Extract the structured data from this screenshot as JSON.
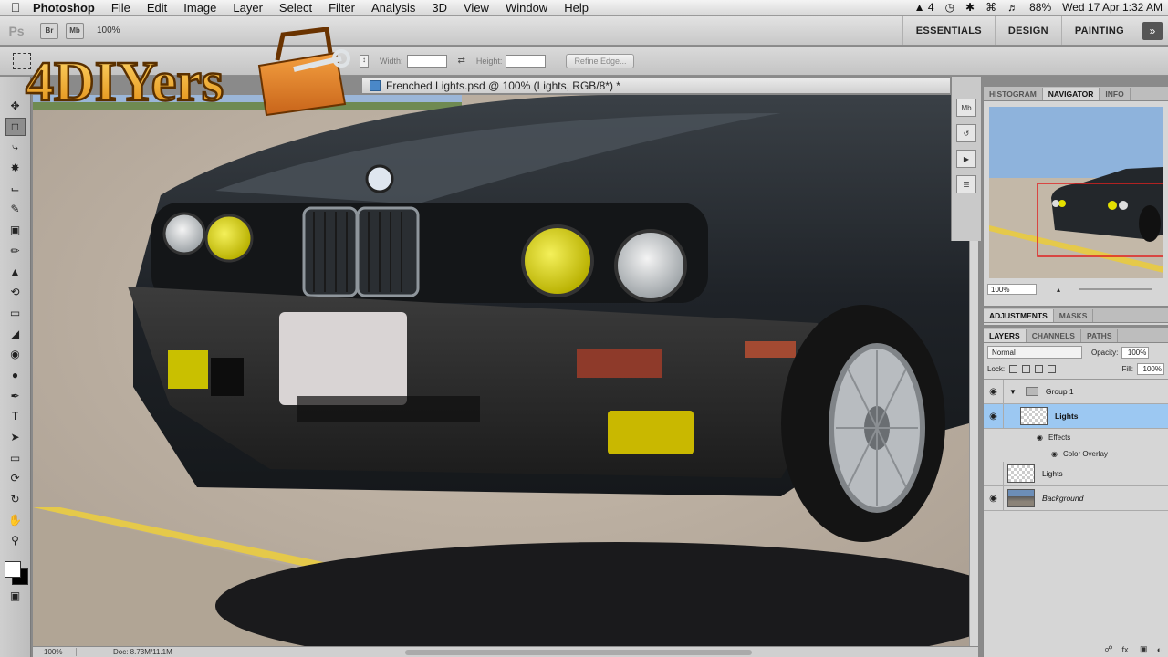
{
  "menubar": {
    "app_name": "Photoshop",
    "menus": [
      "File",
      "Edit",
      "Image",
      "Layer",
      "Select",
      "Filter",
      "Analysis",
      "3D",
      "View",
      "Window",
      "Help"
    ],
    "status": {
      "adobe_count": "4",
      "battery": "88%",
      "datetime": "Wed 17 Apr  1:32 AM"
    }
  },
  "appbar": {
    "ps_label": "Ps",
    "bridge": "Br",
    "minibridge": "Mb",
    "zoom": "100%",
    "workspaces": [
      "ESSENTIALS",
      "DESIGN",
      "PAINTING"
    ]
  },
  "options": {
    "width_label": "Width:",
    "height_label": "Height:",
    "refine_label": "Refine Edge..."
  },
  "document": {
    "title": "Frenched Lights.psd @ 100% (Lights, RGB/8*) *",
    "zoom": "100%",
    "doc_info": "Doc: 8.73M/11.1M"
  },
  "navigator_panel": {
    "tabs": [
      "HISTOGRAM",
      "NAVIGATOR",
      "INFO"
    ],
    "active_tab": "NAVIGATOR",
    "zoom": "100%"
  },
  "adjust_panel": {
    "tabs": [
      "ADJUSTMENTS",
      "MASKS"
    ]
  },
  "layers_panel": {
    "tabs": [
      "LAYERS",
      "CHANNELS",
      "PATHS"
    ],
    "blend_mode": "Normal",
    "opacity_label": "Opacity:",
    "opacity": "100%",
    "lock_label": "Lock:",
    "fill_label": "Fill:",
    "fill": "100%",
    "group": "Group 1",
    "selected_layer": "Lights",
    "effects_label": "Effects",
    "effect": "Color Overlay",
    "layer2": "Lights",
    "background": "Background"
  },
  "logo": {
    "text": "4DIYers"
  }
}
